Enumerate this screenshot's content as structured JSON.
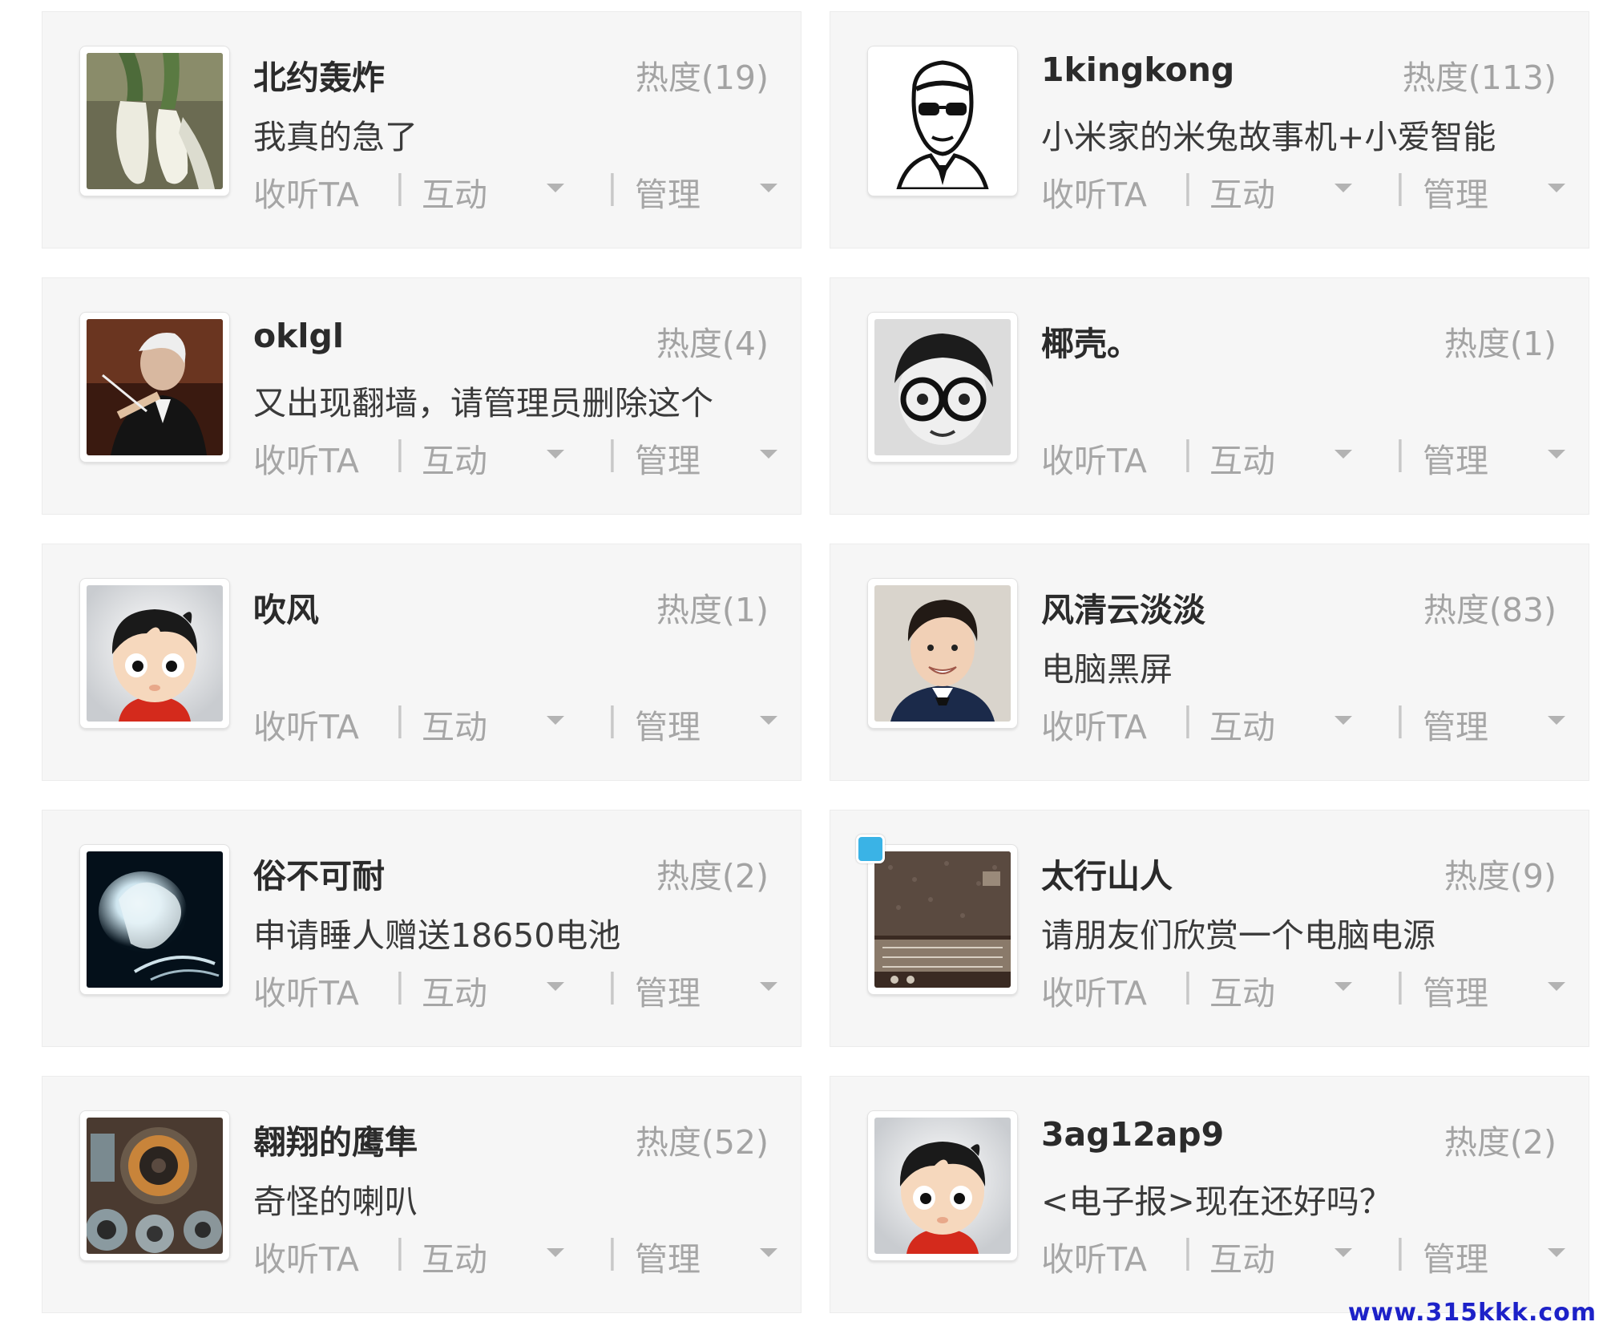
{
  "watermark": "www.315kkk.com",
  "actions": {
    "follow": "收听TA",
    "interact": "互动",
    "manage": "管理",
    "separator": "|"
  },
  "users": [
    {
      "name": "北约轰炸",
      "heat": "热度(19)",
      "post": "我真的急了",
      "avatar": "white-radish-photo"
    },
    {
      "name": "1kingkong",
      "heat": "热度(113)",
      "post": "小米家的米兔故事机+小爱智能",
      "avatar": "sketch-man-sunglasses"
    },
    {
      "name": "oklgl",
      "heat": "热度(4)",
      "post": "又出现翻墙，请管理员删除这个",
      "avatar": "conductor-photo"
    },
    {
      "name": "椰壳。",
      "heat": "热度(1)",
      "post": "",
      "avatar": "child-with-glasses-photo"
    },
    {
      "name": "吹风",
      "heat": "热度(1)",
      "post": "",
      "avatar": "cartoon-boy-avatar"
    },
    {
      "name": "风清云淡淡",
      "heat": "热度(83)",
      "post": "电脑黑屏",
      "avatar": "smiling-man-photo"
    },
    {
      "name": "俗不可耐",
      "heat": "热度(2)",
      "post": "申请睡人赠送18650电池",
      "avatar": "glowing-figure-photo"
    },
    {
      "name": "太行山人",
      "heat": "热度(9)",
      "post": "请朋友们欣赏一个电脑电源",
      "avatar": "old-radio-photo",
      "badge": true
    },
    {
      "name": "翱翔的鹰隼",
      "heat": "热度(52)",
      "post": "奇怪的喇叭",
      "avatar": "speakers-photo"
    },
    {
      "name": "3ag12ap9",
      "heat": "热度(2)",
      "post": "<电子报>现在还好吗？",
      "avatar": "cartoon-boy-avatar"
    }
  ]
}
